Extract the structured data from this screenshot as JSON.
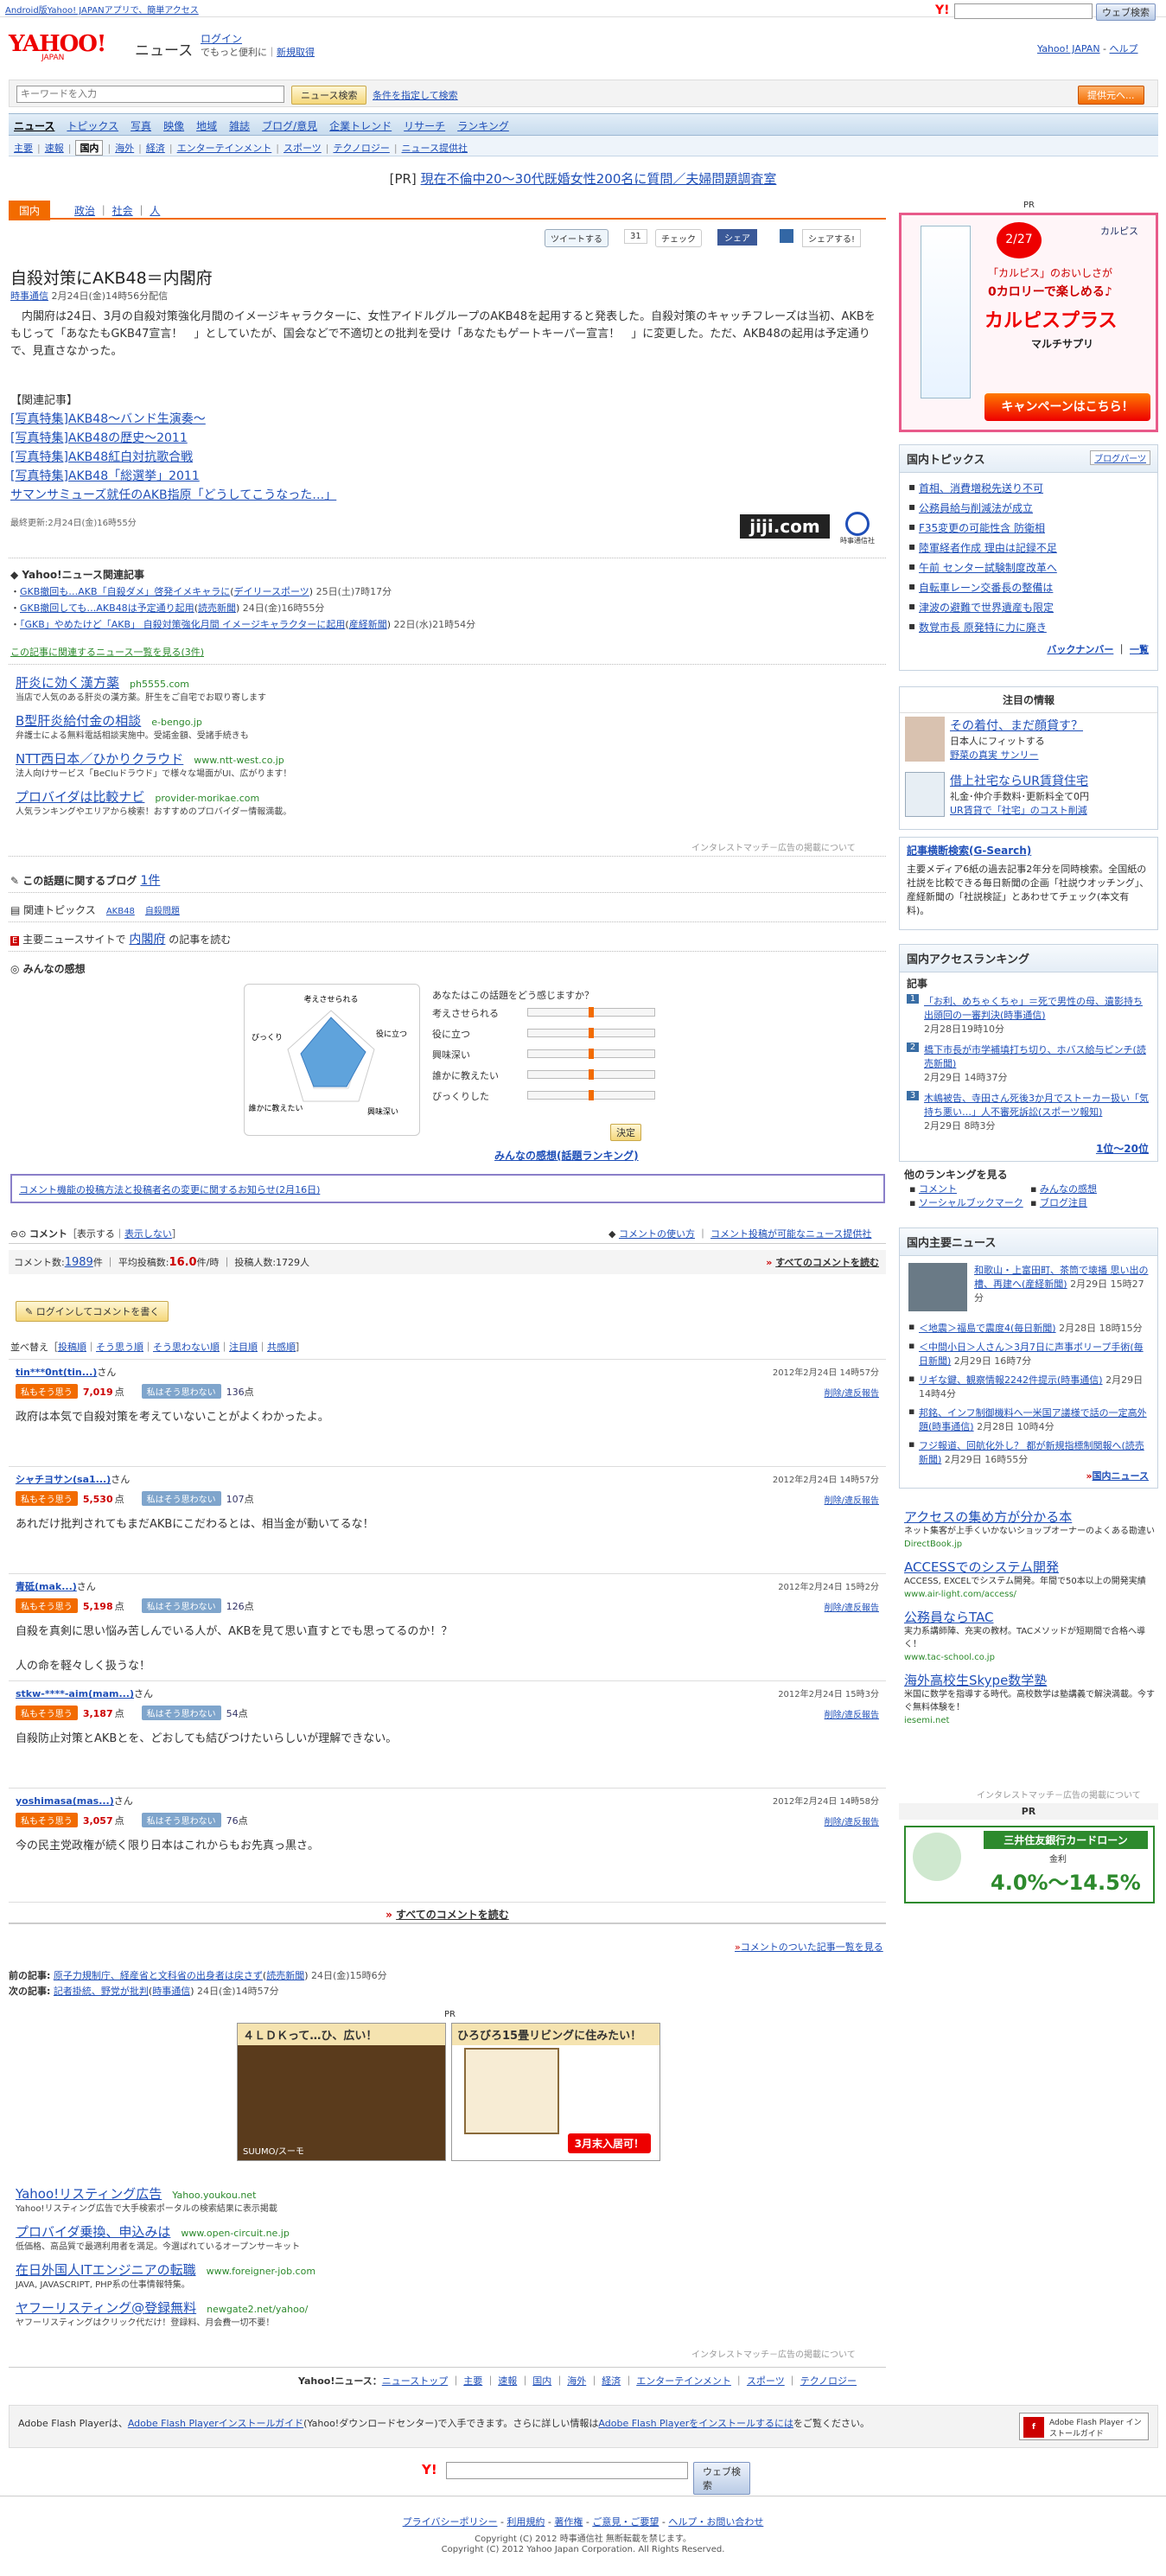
{
  "topbar": {
    "android_link": "Android版Yahoo! JAPANアプリで、簡単アクセス",
    "web_search": "ウェブ検索"
  },
  "header": {
    "logo": "YAHOO! JAPAN",
    "section": "ニュース",
    "login": "ログイン",
    "login_note": "でもっと便利に",
    "register": "新規取得",
    "yj_link": "Yahoo! JAPAN",
    "help": "ヘルプ"
  },
  "search": {
    "placeholder": "キーワードを入力",
    "button": "ニュース検索",
    "advanced": "条件を指定して検索",
    "post_button": "提供元へ..."
  },
  "nav": {
    "tabs": [
      "ニュース",
      "トピックス",
      "写真",
      "映像",
      "地域",
      "雑誌",
      "ブログ/意見",
      "企業トレンド",
      "リサーチ",
      "ランキング"
    ],
    "sub": [
      "主要",
      "速報",
      "国内",
      "海外",
      "経済",
      "エンターテインメント",
      "スポーツ",
      "テクノロジー",
      "ニュース提供社"
    ]
  },
  "pr_banner": {
    "label": "[PR]",
    "text": "現在不倫中20～30代既婚女性200名に質問／夫婦問題調査室"
  },
  "breadcrumb": {
    "current": "国内",
    "items": [
      "政治",
      "社会",
      "人"
    ]
  },
  "social": {
    "tweet": "ツイートする",
    "tweet_count": "31",
    "check": "チェック",
    "share": "シェア",
    "yshare": "シェアする!"
  },
  "article": {
    "title": "自殺対策にAKB48＝内閣府",
    "source": "時事通信",
    "date": "2月24日(金)14時56分配信",
    "body": "　内閣府は24日、3月の自殺対策強化月間のイメージキャラクターに、女性アイドルグループのAKB48を起用すると発表した。自殺対策のキャッチフレーズは当初、AKBをもじって「あなたもGKB47宣言！　」としていたが、国会などで不適切との批判を受け「あなたもゲートキーパー宣言！　」に変更した。ただ、AKB48の起用は予定通りで、見直さなかった。",
    "related_head": "【関連記事】",
    "related": [
      "[写真特集]AKB48～バンド生演奏～",
      "[写真特集]AKB48の歴史～2011",
      "[写真特集]AKB48紅白対抗歌合戦",
      "[写真特集]AKB48「総選挙」2011",
      "サマンサミューズ就任のAKB指原「どうしてこうなった…」"
    ],
    "updated": "最終更新:2月24日(金)16時55分",
    "jiji_logo": "jiji.com",
    "jiji_sub": "時事通信社"
  },
  "related_news": {
    "head": "Yahoo!ニュース関連記事",
    "items": [
      {
        "text": "GKB撤回も…AKB「自殺ダメ」啓発イメキャラに",
        "src": "デイリースポーツ",
        "time": "25日(土)7時17分"
      },
      {
        "text": "GKB撤回しても…AKB48は予定通り起用",
        "src": "読売新聞",
        "time": "24日(金)16時55分"
      },
      {
        "text": "「GKB」やめたけど「AKB」 自殺対策強化月間 イメージキャラクターに起用",
        "src": "産経新聞",
        "time": "22日(水)21時54分"
      }
    ],
    "more": "この記事に関連するニュース一覧を見る(3件)"
  },
  "ads1": [
    {
      "title": "肝炎に効く漢方薬",
      "url": "ph5555.com",
      "desc": "当店で人気のある肝炎の漢方薬。肝生をご自宅でお取り寄します"
    },
    {
      "title": "B型肝炎給付金の相談",
      "url": "e-bengo.jp",
      "desc": "弁護士による無料電話相談実施中。受諾金額、受諸手続きも"
    },
    {
      "title": "NTT西日本／ひかりクラウド",
      "url": "www.ntt-west.co.jp",
      "desc": "法人向けサービス「BeCluドラウド」で様々な場面がUI、広がります！"
    },
    {
      "title": "プロバイダは比較ナビ",
      "url": "provider-morikae.com",
      "desc": "人気ランキングやエリアから検索！おすすめのプロバイダー情報満載。"
    }
  ],
  "ads_footer": "インタレストマッチ－広告の掲載について",
  "blog": {
    "label": "この話題に関するブログ",
    "count": "1件"
  },
  "topics": {
    "label": "関連トピックス",
    "items": [
      "AKB48",
      "自殺問題"
    ]
  },
  "major": {
    "label": "主要ニュースサイトで",
    "link": "内閣府",
    "suffix": "の記事を読む"
  },
  "feeling": {
    "head": "みんなの感想",
    "question": "あなたはこの話題をどう感じますか？",
    "axes": [
      "考えさせられる",
      "役に立つ",
      "興味深い",
      "誰かに教えたい",
      "びっくりした"
    ],
    "radar_labels": [
      "考えさせられる",
      "役に立つ",
      "興味深い",
      "誰かに教えたい",
      "びっくり"
    ],
    "decide": "決定",
    "ranking": "みんなの感想(話題ランキング)"
  },
  "notice": "コメント機能の投稿方法と投稿者名の変更に関するお知らせ(2月16日)",
  "comments": {
    "title": "コメント",
    "show": "表示する",
    "hide": "表示しない",
    "howto": "コメントの使い方",
    "list": "コメント投稿が可能なニュース提供社",
    "count_label": "コメント数:",
    "count": "1989",
    "avg_label": "平均投稿数:",
    "avg": "16.0",
    "avg_unit": "件/時",
    "users_label": "投稿人数:",
    "users": "1729人",
    "all": "すべてのコメントを読む",
    "login_btn": "ログインしてコメントを書く",
    "sort_label": "並べ替え",
    "sort": [
      "投稿順",
      "そう思う順",
      "そう思わない順",
      "注目順",
      "共感順"
    ],
    "agree": "私もそう思う",
    "disagree": "私はそう思わない",
    "delete": "削除/違反報告",
    "items": [
      {
        "user": "tin***0nt(tin...)",
        "date": "2012年2月24日 14時57分",
        "agree": "7,019",
        "disagree": "136",
        "text": "政府は本気で自殺対策を考えていないことがよくわかったよ。"
      },
      {
        "user": "シャチヨサン(sa1...)",
        "date": "2012年2月24日 14時57分",
        "agree": "5,530",
        "disagree": "107",
        "text": "あれだけ批判されてもまだAKBにこだわるとは、相当金が動いてるな！"
      },
      {
        "user": "青砥(mak...)",
        "date": "2012年2月24日 15時2分",
        "agree": "5,198",
        "disagree": "126",
        "text": "自殺を真剣に思い悩み苦しんでいる人が、AKBを見て思い直すとでも思ってるのか！？\n\n人の命を軽々しく扱うな！"
      },
      {
        "user": "stkw-****-aim(mam...)",
        "date": "2012年2月24日 15時3分",
        "agree": "3,187",
        "disagree": "54",
        "text": "自殺防止対策とAKBとを、どおしても結びつけたいらしいが理解できない。"
      },
      {
        "user": "yoshimasa(mas...)",
        "date": "2012年2月24日 14時58分",
        "agree": "3,057",
        "disagree": "76",
        "text": "今の民主党政権が続く限り日本はこれからもお先真っ黒さ。"
      }
    ],
    "read_all": "すべてのコメントを読む",
    "article_list": "コメントのついた記事一覧を見る",
    "pt": "点",
    "san": "さん"
  },
  "prevnext": {
    "prev_label": "前の記事:",
    "prev": "原子力規制庁、経産省と文科省の出身者は戻さず",
    "prev_src": "読売新聞",
    "prev_time": "24日(金)15時6分",
    "next_label": "次の記事:",
    "next": "記者掛統、野党が批判",
    "next_src": "時事通信",
    "next_time": "24日(金)14時57分"
  },
  "pr2": {
    "label": "PR",
    "left": "４ＬＤＫって…ひ、広い！",
    "left_brand": "SUUMO/スーモ",
    "right": "ひろびろ15畳リビングに住みたい！",
    "right_btn": "3月末入居可！"
  },
  "ads2": [
    {
      "title": "Yahoo!リスティング広告",
      "url": "Yahoo.youkou.net",
      "desc": "Yahoo!リスティング広告で大手検索ポータルの検索結果に表示掲載"
    },
    {
      "title": "プロバイダ乗換、申込みは",
      "url": "www.open-circuit.ne.jp",
      "desc": "低価格、高品質で最適利用者を満足。今選ばれているオープンサーキット"
    },
    {
      "title": "在日外国人ITエンジニアの転職",
      "url": "www.foreigner-job.com",
      "desc": "JAVA, JAVASCRIPT, PHP系の仕事情報特集。"
    },
    {
      "title": "ヤフーリスティング@登録無料",
      "url": "newgate2.net/yahoo/",
      "desc": "ヤフーリスティングはクリック代だけ！登録料、月会費一切不要！"
    }
  ],
  "footer_nav": {
    "label": "Yahoo!ニュース：",
    "items": [
      "ニューストップ",
      "主要",
      "速報",
      "国内",
      "海外",
      "経済",
      "エンターテインメント",
      "スポーツ",
      "テクノロジー"
    ]
  },
  "flash": {
    "text": "Adobe Flash Playerは、",
    "link1": "Adobe Flash Playerインストールガイド",
    "mid": "(Yahoo!ダウンロードセンター)で入手できます。さらに詳しい情報は",
    "link2": "Adobe Flash Playerをインストールするには",
    "end": "をご覧ください。",
    "badge": "Adobe Flash Player インストールガイド"
  },
  "bottom": {
    "search_btn": "ウェブ検索",
    "links": [
      "プライバシーポリシー",
      "利用規約",
      "著作権",
      "ご意見・ご要望",
      "ヘルプ・お問い合わせ"
    ],
    "copy1": "Copyright (C) 2012 時事通信社 無断転載を禁じます。",
    "copy2": "Copyright (C) 2012 Yahoo Japan Corporation. All Rights Reserved."
  },
  "sidebar": {
    "pr": "PR",
    "calpis": {
      "date": "2/27",
      "brand": "カルピス",
      "text1": "「カルピス」のおいしさが",
      "text2": "0カロリーで楽しめる♪",
      "product": "カルピスプラス",
      "sub": "マルチサプリ",
      "campaign": "キャンペーンはこちら！"
    },
    "topics_head": "国内トピックス",
    "blog_ranking": "ブログパーツ",
    "topics": [
      "首相、消費増税先送り不可",
      "公務員給与削減法が成立",
      "F35変更の可能性含 防衛相",
      "陸軍経者作成 理由は記録不足",
      "午前 センター試験制度改革へ",
      "自転車レーン交番長の整備は",
      "津波の避難で世界遺産も限定",
      "数覚市長 原発特に力に廃き"
    ],
    "topics_more": [
      "バックナンバー",
      "一覧"
    ],
    "chuumoku": "注目の情報",
    "chuumoku_items": [
      {
        "t": "その着付、まだ顔貸す？",
        "s": "日本人にフィットする",
        "s2": "野菜の真実 サンリー"
      },
      {
        "t": "借上社宅ならUR賃貸住宅",
        "s": "礼金･仲介手数料･更新料全て0円",
        "s2": "UR賃貸で「社宅」のコスト削減"
      }
    ],
    "gsearch_head": "記事横断検索(G-Search)",
    "gsearch_text": "主要メディア6紙の過去記事2年分を同時検索。全国紙の社説を比較できる毎日新聞の企画「社説ウオッチング」、産経新聞の「社説検証」とあわせてチェック(本文有料)。",
    "ranking_head": "国内アクセスランキング",
    "ranking_sub": "記事",
    "ranking": [
      {
        "t": "「お利、めちゃくちゃ」＝死で男性の母、遺影持ち出頭回の一審判決(時事通信)",
        "time": "2月28日19時10分"
      },
      {
        "t": "橋下市長が市学補填打ち切り、ホバス給与ピンチ(読売新聞)",
        "time": "2月29日 14時37分"
      },
      {
        "t": "木嶋被告、寺田さん死後3か月でストーカー扱い「気持ち悪い…」人不審死訴訟(スポーツ報知)",
        "time": "2月29日 8時3分"
      }
    ],
    "ranking_more": "1位～20位",
    "other_head": "他のランキングを見る",
    "other": [
      "コメント",
      "ソーシャルブックマーク",
      "みんなの感想",
      "ブログ注目"
    ],
    "kokunai_head": "国内主要ニュース",
    "kokunai_top": "和歌山・上富田町、茶筒で壊播 思い出の槽、再建へ(産経新聞)",
    "kokunai_top_time": "2月29日 15時27分",
    "kokunai": [
      {
        "t": "＜地震＞福島で震度4(毎日新聞)",
        "time": "2月28日 18時15分"
      },
      {
        "t": "＜中間小日＞人さん＞3月7日に声事ボリープ手術(毎日新聞)",
        "time": "2月29日 16時7分"
      },
      {
        "t": "リギな鍵、観察情報2242件提示(時事通信)",
        "time": "2月29日 14時4分"
      },
      {
        "t": "邦銘、インフ制御機料へ一米国ア議様で話の一定高外題(時事通信)",
        "time": "2月28日 10時4分"
      },
      {
        "t": "フジ報道、回航化外し？ 都が新規指標制関報へ(読売新聞)",
        "time": "2月29日 16時55分"
      }
    ],
    "kokunai_more": "国内ニュース",
    "ads": [
      {
        "title": "アクセスの集め方が分かる本",
        "desc": "ネット集客が上手くいかないショップオーナーのよくある勘違い",
        "url": "DirectBook.jp"
      },
      {
        "title": "ACCESSでのシステム開発",
        "desc": "ACCESS, EXCELでシステム開発。年間で50本以上の開発実績",
        "url": "www.air-light.com/access/"
      },
      {
        "title": "公務員ならTAC",
        "desc": "実力系講師陣、充実の教材。TACメソッドが短期間で合格へ導く！",
        "url": "www.tac-school.co.jp"
      },
      {
        "title": "海外高校生Skype数学塾",
        "desc": "米国に数学を指導する時代。高校数学は塾講義で解決満載。今すぐ無料体験を！",
        "url": "iesemi.net"
      }
    ],
    "ads_footer": "インタレストマッチ－広告の掲載について",
    "pr2": "PR",
    "loan_title": "三井住友銀行カードローン",
    "loan_rate": "4.0%～14.5%",
    "loan_label": "金利"
  },
  "colors": {
    "accent": "#f26b00",
    "link": "#1f4fb8",
    "nav": "#c8dcee"
  }
}
